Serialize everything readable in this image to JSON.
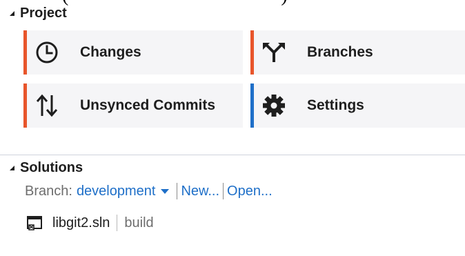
{
  "clipped_text": "(                                            )",
  "project": {
    "title": "Project",
    "tiles": [
      {
        "label": "Changes",
        "icon": "clock-icon",
        "accent": "#e8552b"
      },
      {
        "label": "Branches",
        "icon": "branch-icon",
        "accent": "#e8552b"
      },
      {
        "label": "Unsynced Commits",
        "icon": "sync-arrows-icon",
        "accent": "#e8552b"
      },
      {
        "label": "Settings",
        "icon": "gear-icon",
        "accent": "#1e6fc8"
      }
    ]
  },
  "solutions": {
    "title": "Solutions",
    "branch_label": "Branch:",
    "branch_value": "development",
    "new_link": "New...",
    "open_link": "Open...",
    "solution": {
      "name": "libgit2.sln",
      "config": "build"
    }
  },
  "colors": {
    "link": "#1e6fc8",
    "accent_orange": "#e8552b",
    "accent_blue": "#1e6fc8",
    "tile_background": "#f5f5f7"
  }
}
